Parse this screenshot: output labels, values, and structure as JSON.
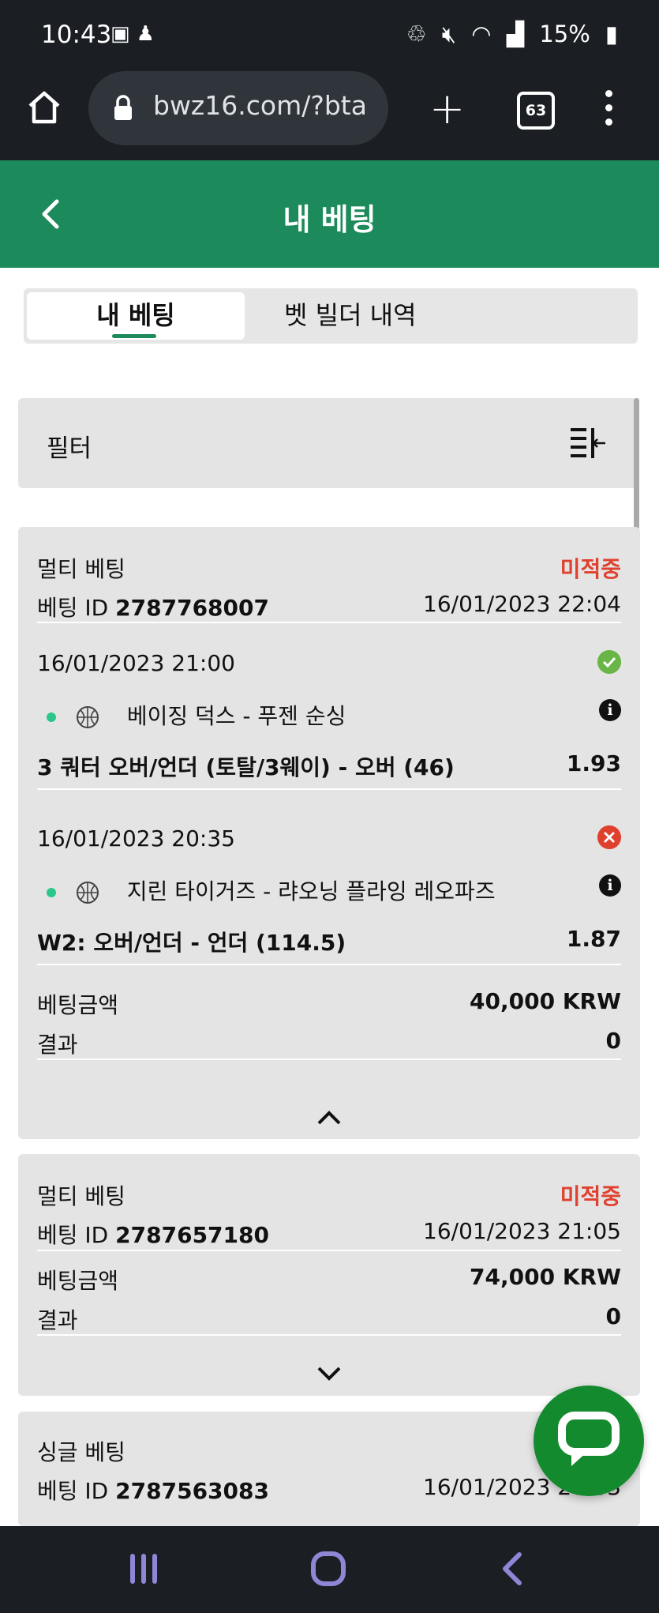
{
  "status_bar": {
    "time": "10:43",
    "battery": "15%",
    "left_icons": [
      "image-icon",
      "notification-icon"
    ],
    "right_icons": [
      "battery-saver-icon",
      "mute-icon",
      "wifi-icon",
      "signal-icon",
      "battery-icon"
    ]
  },
  "browser": {
    "url": "bwz16.com/?bta",
    "tab_count": "63"
  },
  "header": {
    "title": "내 베팅"
  },
  "tabs": [
    {
      "label": "내 베팅",
      "active": true
    },
    {
      "label": "벳 빌더 내역",
      "active": false
    }
  ],
  "filter": {
    "label": "필터"
  },
  "bets": [
    {
      "type": "멀티 베팅",
      "status": "미적중",
      "id_label": "베팅 ID",
      "id": "2787768007",
      "datetime": "16/01/2023 22:04",
      "selections": [
        {
          "datetime": "16/01/2023 21:00",
          "result": "won",
          "match": "베이징 덕스 - 푸젠 순싱",
          "market": "3 쿼터 오버/언더 (토탈/3웨이) - 오버 (46)",
          "odds": "1.93"
        },
        {
          "datetime": "16/01/2023 20:35",
          "result": "lost",
          "match": "지린 타이거즈 - 랴오닝 플라잉 레오파즈",
          "market": "W2: 오버/언더 - 언더 (114.5)",
          "odds": "1.87"
        }
      ],
      "stake_label": "베팅금액",
      "stake": "40,000 KRW",
      "result_label": "결과",
      "result": "0",
      "expanded": true
    },
    {
      "type": "멀티 베팅",
      "status": "미적중",
      "id_label": "베팅 ID",
      "id": "2787657180",
      "datetime": "16/01/2023 21:05",
      "stake_label": "베팅금액",
      "stake": "74,000 KRW",
      "result_label": "결과",
      "result": "0",
      "expanded": false
    },
    {
      "type": "싱글 베팅",
      "id_label": "베팅 ID",
      "id": "2787563083",
      "datetime": "16/01/2023 20:03"
    }
  ],
  "colors": {
    "brand_green": "#1d8a5b",
    "status_miss": "#e0412e",
    "win_green": "#6ab547",
    "live_dot": "#2bc78a",
    "chat_green": "#148a2f",
    "nav_accent": "#8f86d6"
  }
}
